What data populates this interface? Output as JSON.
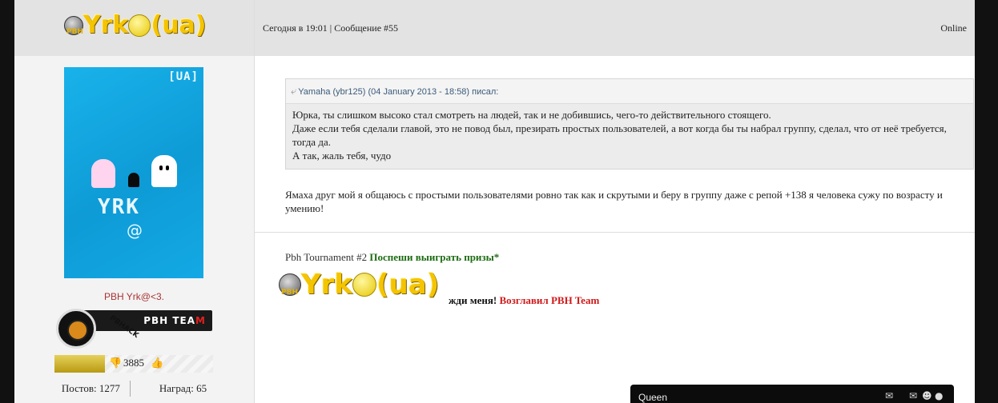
{
  "author": {
    "logo_prefix": "PBH",
    "logo_text": "Yrk",
    "logo_suffix": "(ua)",
    "avatar_tag": "[UA]",
    "avatar_text": "YRK",
    "avatar_at": "@",
    "username": "PBH Yrk@<3.",
    "team_label_main": "PBH TEA",
    "team_label_end": "M",
    "team_diag": "PBHACK",
    "reputation": "3885",
    "reputation_fill_fraction": 0.32,
    "posts_label": "Постов: 1277",
    "awards_label": "Наград: 65"
  },
  "post": {
    "meta": "Сегодня в 19:01 | Сообщение #55",
    "status": "Online",
    "quote_header": "Yamaha (ybr125) (04 January 2013 - 18:58) писал:",
    "quote_lines": [
      "Юрка, ты слишком высоко стал смотреть на людей, так и не добившись, чего-то действительного стоящего.",
      "Даже если тебя сделали главой, это не повод был, презирать простых пользователей, а вот когда бы ты набрал группу, сделал, что от неё требуется, тогда да.",
      "А так, жаль тебя, чудо"
    ],
    "reply": "Ямаха друг мой я общаюсь с простыми пользователями ровно так как и скрутыми и беру в группу даже с репой +138 я человека сужу по возрасту и умению!"
  },
  "signature": {
    "line1_plain": "Pbh Tournament #2 ",
    "line1_green": "Поспеши выиграть призы*",
    "line2_plain": "жди меня! ",
    "line2_red": "Возглавил PBH Team"
  },
  "chat": {
    "name": "Queen",
    "icons": [
      "chat-icon",
      "mail-icon",
      "people-icon",
      "user-icon"
    ]
  }
}
